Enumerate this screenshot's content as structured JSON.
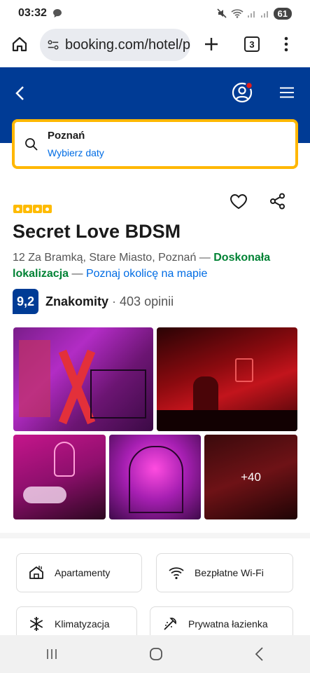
{
  "status_bar": {
    "time": "03:32",
    "battery": "61"
  },
  "browser": {
    "url": "booking.com/hotel/p",
    "tab_count": "3"
  },
  "search": {
    "destination": "Poznań",
    "dates_link": "Wybierz daty"
  },
  "hotel": {
    "stars": 4,
    "name": "Secret Love BDSM",
    "address": "12 Za Bramką, Stare Miasto, Poznań",
    "dash1": " — ",
    "location_badge": "Doskonała lokalizacja",
    "dash2": " — ",
    "map_link": "Poznaj okolicę na mapie",
    "score": "9,2",
    "score_word": "Znakomity",
    "score_sep": "·",
    "reviews": "403 opinii"
  },
  "photos": {
    "more_label": "+40"
  },
  "facilities": [
    {
      "label": "Apartamenty",
      "icon": "house-icon"
    },
    {
      "label": "Bezpłatne Wi-Fi",
      "icon": "wifi-icon"
    },
    {
      "label": "Klimatyzacja",
      "icon": "snowflake-icon"
    },
    {
      "label": "Prywatna łazienka",
      "icon": "shower-icon"
    }
  ],
  "colors": {
    "brand": "#003b95",
    "accent": "#ffb700",
    "link": "#006ce4",
    "green": "#008234"
  }
}
